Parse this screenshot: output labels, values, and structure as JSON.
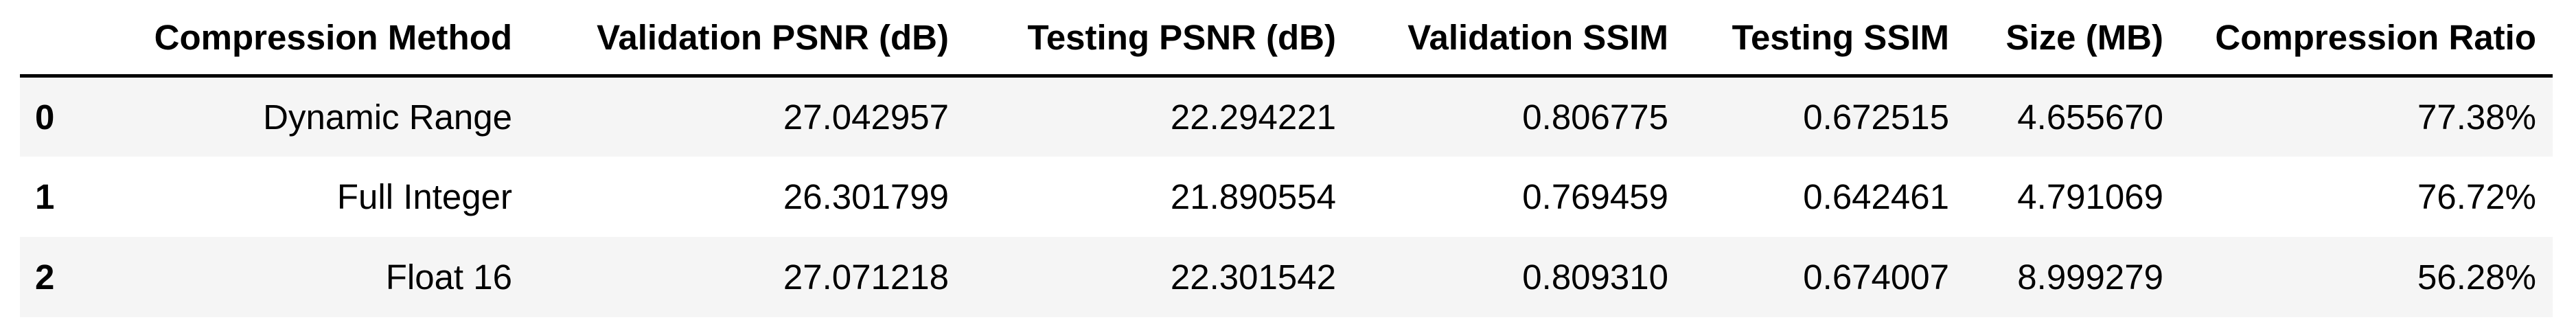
{
  "table": {
    "columns": [
      "",
      "Compression Method",
      "Validation PSNR (dB)",
      "Testing PSNR (dB)",
      "Validation SSIM",
      "Testing SSIM",
      "Size (MB)",
      "Compression Ratio"
    ],
    "rows": [
      {
        "index": "0",
        "method": "Dynamic Range",
        "val_psnr": "27.042957",
        "test_psnr": "22.294221",
        "val_ssim": "0.806775",
        "test_ssim": "0.672515",
        "size_mb": "4.655670",
        "ratio": "77.38%"
      },
      {
        "index": "1",
        "method": "Full Integer",
        "val_psnr": "26.301799",
        "test_psnr": "21.890554",
        "val_ssim": "0.769459",
        "test_ssim": "0.642461",
        "size_mb": "4.791069",
        "ratio": "76.72%"
      },
      {
        "index": "2",
        "method": "Float 16",
        "val_psnr": "27.071218",
        "test_psnr": "22.301542",
        "val_ssim": "0.809310",
        "test_ssim": "0.674007",
        "size_mb": "8.999279",
        "ratio": "56.28%"
      }
    ]
  },
  "colors": {
    "stripe": "#f5f5f5",
    "background": "#ffffff",
    "header_rule": "#000000"
  }
}
